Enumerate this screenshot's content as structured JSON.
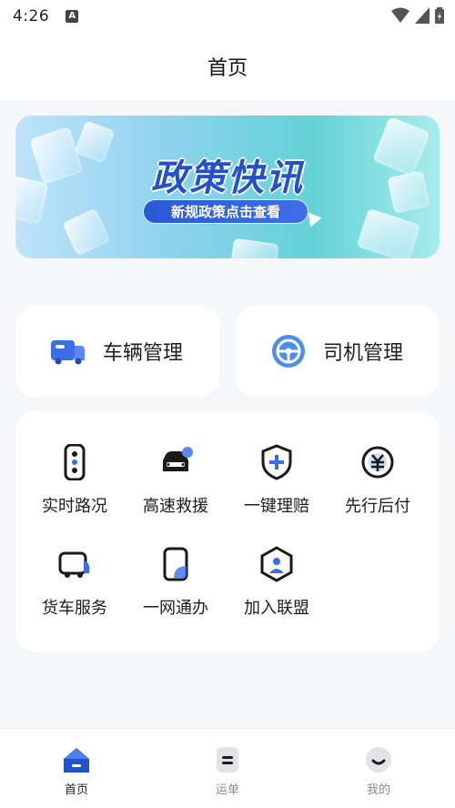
{
  "status": {
    "time": "4:26",
    "notification_glyph": "A"
  },
  "header": {
    "title": "首页"
  },
  "banner": {
    "title": "政策快讯",
    "button_label": "新规政策点击查看"
  },
  "quick": [
    {
      "label": "车辆管理",
      "icon": "truck-icon"
    },
    {
      "label": "司机管理",
      "icon": "steering-wheel-icon"
    }
  ],
  "grid": [
    {
      "label": "实时路况",
      "icon": "traffic-light-icon"
    },
    {
      "label": "高速救援",
      "icon": "rescue-car-icon"
    },
    {
      "label": "一键理赔",
      "icon": "shield-plus-icon"
    },
    {
      "label": "先行后付",
      "icon": "yen-coin-icon"
    },
    {
      "label": "货车服务",
      "icon": "truck-service-icon"
    },
    {
      "label": "一网通办",
      "icon": "tablet-icon"
    },
    {
      "label": "加入联盟",
      "icon": "hexagon-person-icon"
    }
  ],
  "nav": [
    {
      "label": "首页",
      "icon": "home-icon",
      "active": true
    },
    {
      "label": "运单",
      "icon": "waybill-icon",
      "active": false
    },
    {
      "label": "我的",
      "icon": "profile-icon",
      "active": false
    }
  ],
  "colors": {
    "accent": "#2152c9",
    "icon_dark": "#1a1a1a",
    "icon_blue": "#3a6ee8"
  }
}
